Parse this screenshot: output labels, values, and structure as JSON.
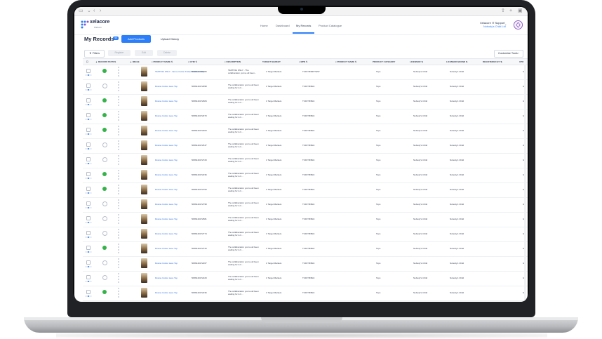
{
  "header": {
    "logo": "xelacore",
    "logo_sub": "Platform",
    "nav": [
      "Home",
      "Dashboard",
      "My Records",
      "Product Catalogue"
    ],
    "active_nav": "My Records",
    "user_name": "Xelacore IT Support",
    "user_org": "Nobody's Child Ltd"
  },
  "page": {
    "title": "My Records",
    "count": "99",
    "add_button": "Add Products",
    "upload_link": "Upload History"
  },
  "toolbar": {
    "filters": "Filters",
    "disabled": [
      "Register",
      "Edit",
      "Delete"
    ],
    "customise": "Customise Tools"
  },
  "table": {
    "headers": [
      "RECORD STATUS",
      "IMAGE",
      "PRODUCT NAME",
      "GTIN",
      "DESCRIPTION",
      "TARGET MARKET",
      "MPN",
      "PRODUCT NAME",
      "PRODUCT CATEGORY",
      "LICENSOR",
      "LICENSOR BRAND",
      "REGISTERED BY",
      "UPD"
    ],
    "rows": [
      {
        "status": "ok",
        "name": "TESTING ONLY - Nome Cotton Knitted Fashion Top",
        "gtin": "5056440265080",
        "desc": "TESTING ONLY - The collaboration you've all been...",
        "market": "1 Target Markets",
        "mpn": "TCD/YB/MP/TEST",
        "cat": "Tops",
        "licensor": "Nobody's Child",
        "brand": "Nobody's Child",
        "upd": "Gui"
      },
      {
        "status": "empty",
        "name": "Rowne Cotton Lace Top",
        "gtin": "5056440172998",
        "desc": "The collaboration you've all been waiting for is b...",
        "market": "1 Target Markets",
        "mpn": "TCD/YB/BLK",
        "cat": "Tops",
        "licensor": "Nobody's Child",
        "brand": "Nobody's Child",
        "upd": "Gui"
      },
      {
        "status": "ok",
        "name": "Rowne Cotton Lace Top",
        "gtin": "5056440172684",
        "desc": "The collaboration you've all been waiting for is b...",
        "market": "1 Target Markets",
        "mpn": "TCD/YB/BLK",
        "cat": "Tops",
        "licensor": "Nobody's Child",
        "brand": "Nobody's Child",
        "upd": "Gui"
      },
      {
        "status": "ok",
        "name": "Rowne Cotton Lace Top",
        "gtin": "5056440172370",
        "desc": "The collaboration you've all been waiting for is b...",
        "market": "1 Target Markets",
        "mpn": "TCD/YB/BLK",
        "cat": "Tops",
        "licensor": "Nobody's Child",
        "brand": "Nobody's Child",
        "upd": "Gui"
      },
      {
        "status": "ok",
        "name": "Rowne Cotton Lace Top",
        "gtin": "5056440172363",
        "desc": "The collaboration you've all been waiting for is b...",
        "market": "1 Target Markets",
        "mpn": "TCD/YB/BLK",
        "cat": "Tops",
        "licensor": "Nobody's Child",
        "brand": "Nobody's Child",
        "upd": "Gui"
      },
      {
        "status": "empty",
        "name": "Rowne Cotton Lace Top",
        "gtin": "5056440172547",
        "desc": "The collaboration you've all been waiting for is b...",
        "market": "1 Target Markets",
        "mpn": "TCD/YB/BLK",
        "cat": "Tops",
        "licensor": "Nobody's Child",
        "brand": "Nobody's Child",
        "upd": "Gui"
      },
      {
        "status": "empty",
        "name": "Rowne Cotton Lace Top",
        "gtin": "5056440172729",
        "desc": "The collaboration you've all been waiting for is b...",
        "market": "1 Target Markets",
        "mpn": "TCD/YB/BLK",
        "cat": "Tops",
        "licensor": "Nobody's Child",
        "brand": "Nobody's Child",
        "upd": "Gui"
      },
      {
        "status": "ok",
        "name": "Rowne Cotton Lace Top",
        "gtin": "5056440172236",
        "desc": "The collaboration you've all been waiting for is b...",
        "market": "1 Target Markets",
        "mpn": "TCD/YB/BLK",
        "cat": "Tops",
        "licensor": "Nobody's Child",
        "brand": "Nobody's Child",
        "upd": "Gui"
      },
      {
        "status": "ok",
        "name": "Rowne Cotton Lace Top",
        "gtin": "5056440172750",
        "desc": "The collaboration you've all been waiting for is b...",
        "market": "1 Target Markets",
        "mpn": "TCD/YB/BLK",
        "cat": "Tops",
        "licensor": "Nobody's Child",
        "brand": "Nobody's Child",
        "upd": "Gui"
      },
      {
        "status": "empty",
        "name": "Rowne Cotton Lace Top",
        "gtin": "5056440172798",
        "desc": "The collaboration you've all been waiting for is b...",
        "market": "1 Target Markets",
        "mpn": "TCD/YB/BLK",
        "cat": "Tops",
        "licensor": "Nobody's Child",
        "brand": "Nobody's Child",
        "upd": "Gui"
      },
      {
        "status": "empty",
        "name": "Rowne Cotton Lace Top",
        "gtin": "5056440172581",
        "desc": "The collaboration you've all been waiting for is b...",
        "market": "1 Target Markets",
        "mpn": "TCD/YB/BLK",
        "cat": "Tops",
        "licensor": "Nobody's Child",
        "brand": "Nobody's Child",
        "upd": "Gui"
      },
      {
        "status": "empty",
        "name": "Rowne Cotton Lace Top",
        "gtin": "5056440172774",
        "desc": "The collaboration you've all been waiting for is b...",
        "market": "1 Target Markets",
        "mpn": "TCD/YB/BLK",
        "cat": "Tops",
        "licensor": "Nobody's Child",
        "brand": "Nobody's Child",
        "upd": "Gui"
      },
      {
        "status": "ok",
        "name": "Rowne Cotton Lace Top",
        "gtin": "5056440172743",
        "desc": "The collaboration you've all been waiting for is b...",
        "market": "1 Target Markets",
        "mpn": "TCD/YB/BLK",
        "cat": "Tops",
        "licensor": "Nobody's Child",
        "brand": "Nobody's Child",
        "upd": "Gui"
      },
      {
        "status": "empty",
        "name": "Rowne Cotton Lace Top",
        "gtin": "5056440172267",
        "desc": "The collaboration you've all been waiting for is b...",
        "market": "1 Target Markets",
        "mpn": "TCD/YB/BLK",
        "cat": "Tops",
        "licensor": "Nobody's Child",
        "brand": "Nobody's Child",
        "upd": "Gui"
      },
      {
        "status": "empty",
        "name": "Rowne Cotton Lace Top",
        "gtin": "5056440172229",
        "desc": "The collaboration you've all been waiting for is b...",
        "market": "1 Target Markets",
        "mpn": "TCD/YB/BLK",
        "cat": "Tops",
        "licensor": "Nobody's Child",
        "brand": "Nobody's Child",
        "upd": "Gui"
      },
      {
        "status": "ok",
        "name": "Rowne Cotton Lace Top",
        "gtin": "5056440172236",
        "desc": "The collaboration you've all been waiting for is b...",
        "market": "1 Target Markets",
        "mpn": "TCD/YB/BLK",
        "cat": "Tops",
        "licensor": "Nobody's Child",
        "brand": "Nobody's Child",
        "upd": "Gui"
      }
    ]
  },
  "colors": {
    "accent": "#2d7ff9",
    "status_ok": "#36b24a",
    "brand_purple": "#8a56c6"
  },
  "icons": [
    "sidebar-toggle-icon",
    "back-icon",
    "forward-icon",
    "share-icon",
    "new-tab-icon",
    "tabs-icon",
    "filter-icon",
    "sort-icon",
    "search-icon",
    "checkbox-icon",
    "status-check-icon"
  ]
}
